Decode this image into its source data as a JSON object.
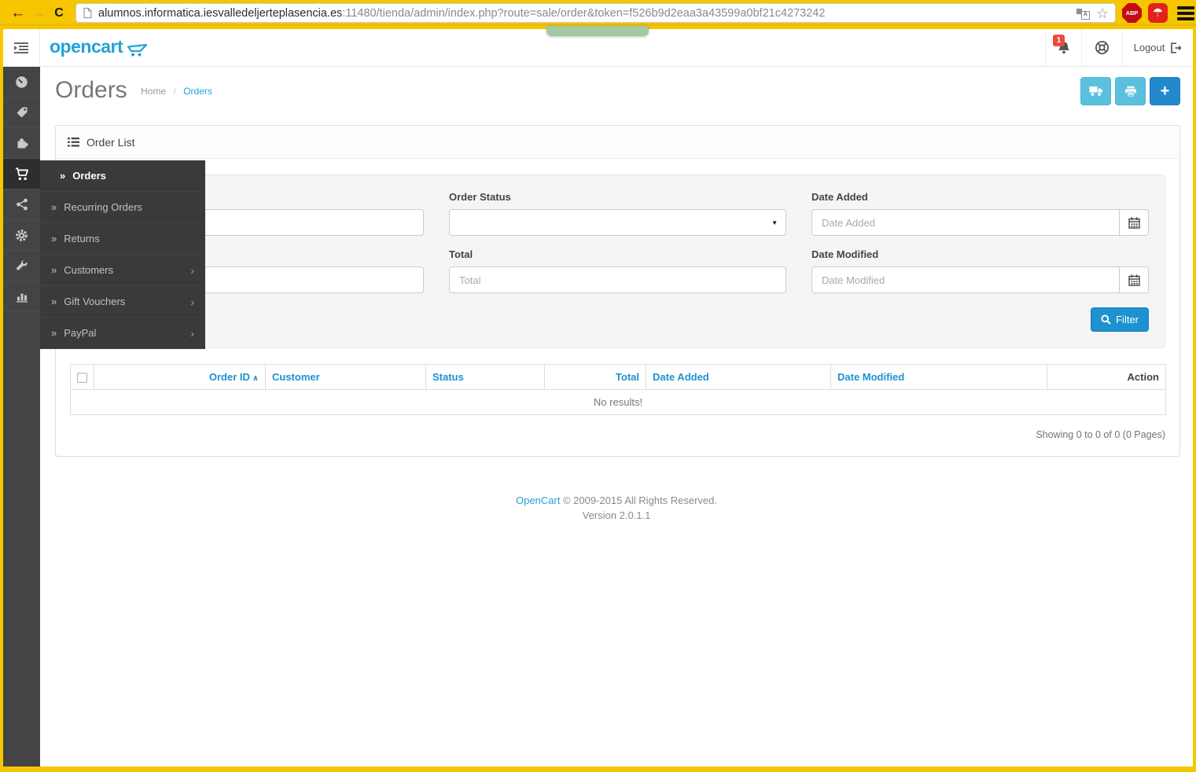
{
  "browser": {
    "url": {
      "host": "alumnos.informatica.iesvalledeljerteplasencia.es",
      "rest": ":11480/tienda/admin/index.php?route=sale/order&token=f526b9d2eaa3a43599a0bf21c4273242"
    },
    "extensions": {
      "adblock": "ABP"
    }
  },
  "icons": {
    "back": "←",
    "forward": "→",
    "reload": "C",
    "star": "☆",
    "umbrella": "☂",
    "translate_letter": "A",
    "menu_chevron": "»",
    "submenu_arrow": "›",
    "select_caret": "▼",
    "sort_asc": "∧",
    "plus": "+"
  },
  "header": {
    "logo": "opencart",
    "notification_count": "1",
    "logout_label": "Logout"
  },
  "sidebar": {
    "items": [
      "dashboard",
      "catalog",
      "extensions",
      "sales",
      "marketing",
      "system",
      "tools",
      "reports"
    ],
    "active": "sales"
  },
  "submenu": {
    "items": [
      {
        "label": "Orders",
        "active": true,
        "expandable": false
      },
      {
        "label": "Recurring Orders",
        "active": false,
        "expandable": false
      },
      {
        "label": "Returns",
        "active": false,
        "expandable": false
      },
      {
        "label": "Customers",
        "active": false,
        "expandable": true
      },
      {
        "label": "Gift Vouchers",
        "active": false,
        "expandable": true
      },
      {
        "label": "PayPal",
        "active": false,
        "expandable": true
      }
    ]
  },
  "page": {
    "title": "Orders",
    "breadcrumb_separator": "/",
    "breadcrumb": [
      {
        "label": "Home"
      },
      {
        "label": "Orders"
      }
    ]
  },
  "panel": {
    "heading": "Order List"
  },
  "filter": {
    "order_status": {
      "label": "Order Status",
      "value": ""
    },
    "total": {
      "label": "Total",
      "placeholder": "Total"
    },
    "date_added": {
      "label": "Date Added",
      "placeholder": "Date Added"
    },
    "date_modified": {
      "label": "Date Modified",
      "placeholder": "Date Modified"
    },
    "button_label": "Filter"
  },
  "table": {
    "columns": [
      {
        "label": "Order ID",
        "sorted": "asc"
      },
      {
        "label": "Customer"
      },
      {
        "label": "Status"
      },
      {
        "label": "Total"
      },
      {
        "label": "Date Added"
      },
      {
        "label": "Date Modified"
      },
      {
        "label": "Action"
      }
    ],
    "empty_text": "No results!",
    "summary": "Showing 0 to 0 of 0 (0 Pages)"
  },
  "footer": {
    "link": "OpenCart",
    "copyright": "© 2009-2015 All Rights Reserved.",
    "version": "Version 2.0.1.1"
  }
}
